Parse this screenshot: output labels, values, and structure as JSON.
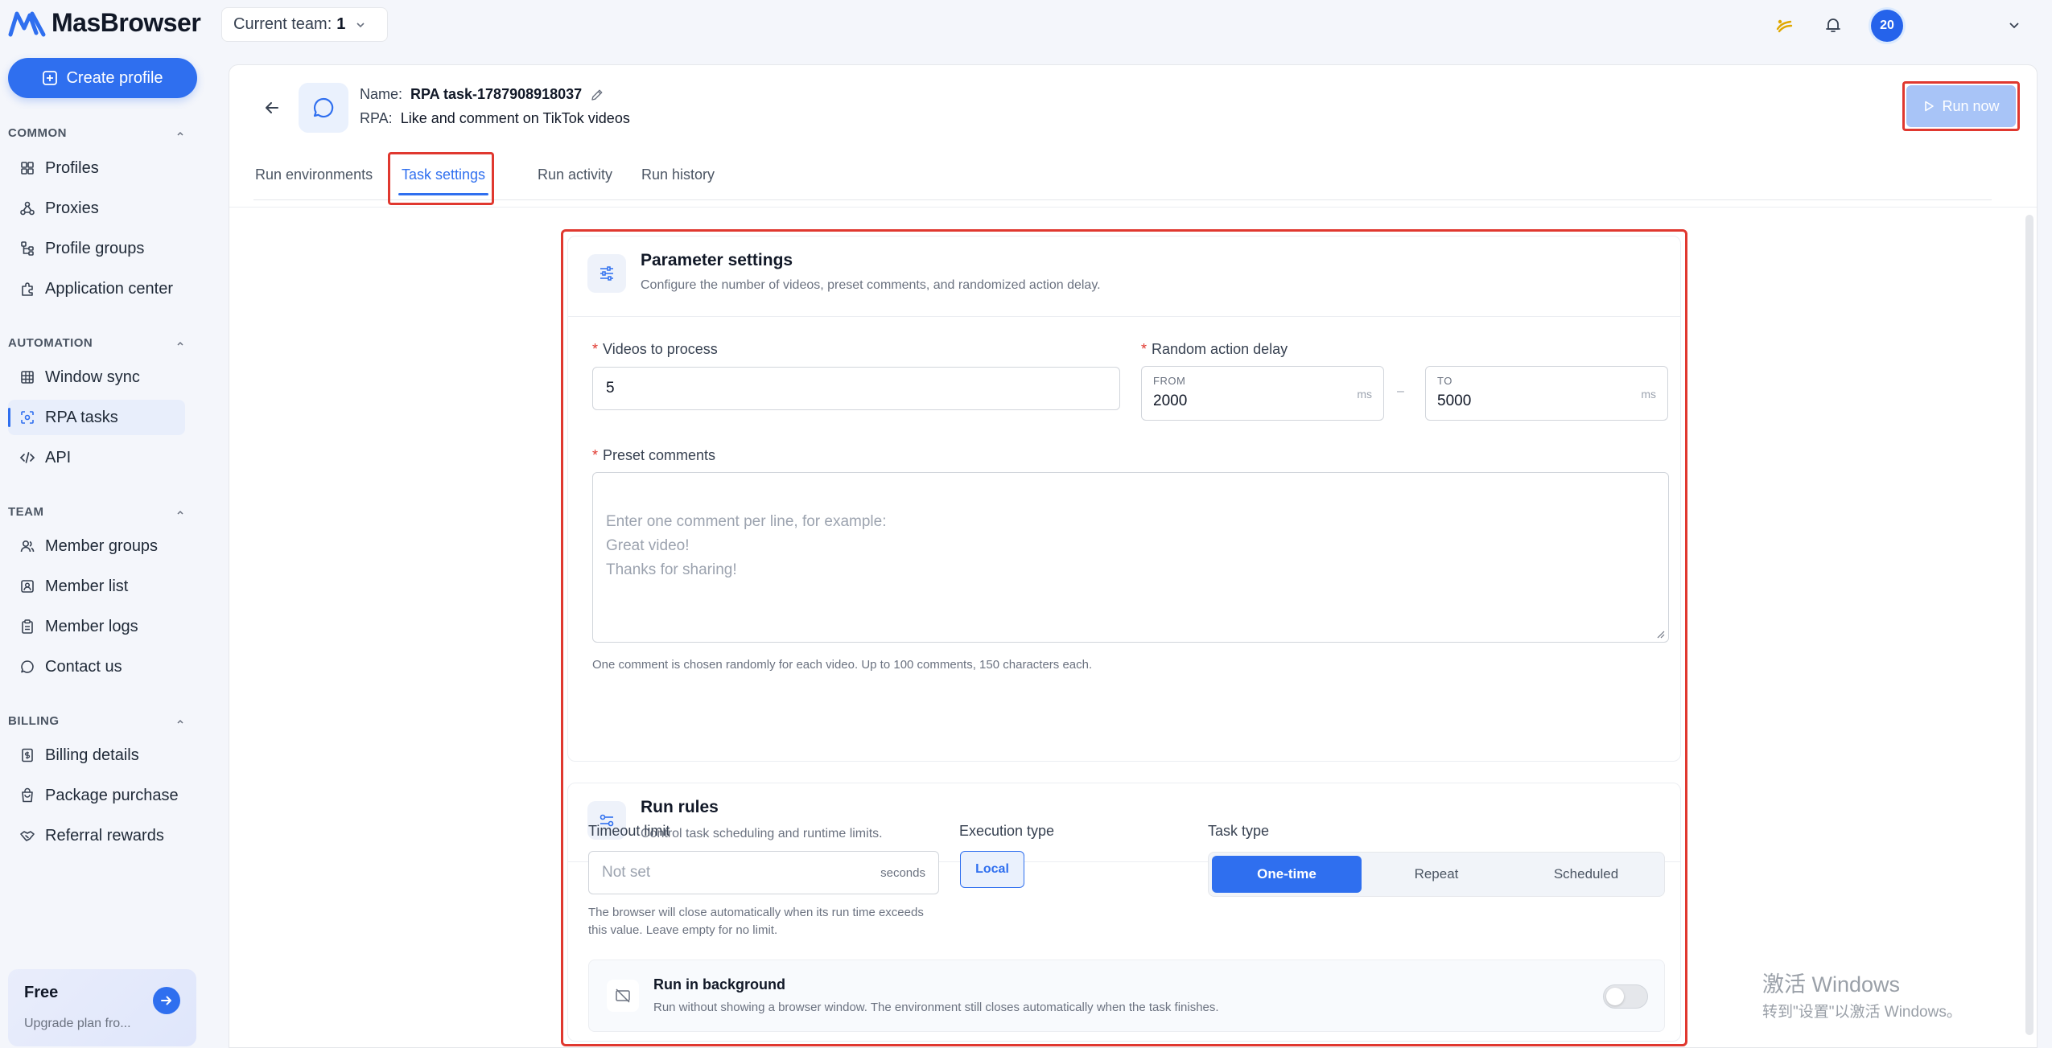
{
  "app": {
    "logo_text": "MasBrowser",
    "team_label": "Current team:",
    "team_value": "1",
    "avatar_text": "20"
  },
  "sidebar": {
    "create_profile": "Create profile",
    "sections": {
      "common": "COMMON",
      "automation": "AUTOMATION",
      "team": "TEAM",
      "billing": "BILLING"
    },
    "items": {
      "profiles": "Profiles",
      "proxies": "Proxies",
      "profile_groups": "Profile groups",
      "application_center": "Application center",
      "window_sync": "Window sync",
      "rpa_tasks": "RPA tasks",
      "api": "API",
      "member_groups": "Member groups",
      "member_list": "Member list",
      "member_logs": "Member logs",
      "contact_us": "Contact us",
      "billing_details": "Billing details",
      "package_purchase": "Package purchase",
      "referral_rewards": "Referral rewards"
    },
    "plan": {
      "name": "Free",
      "subtitle": "Upgrade plan fro..."
    }
  },
  "task": {
    "name_label": "Name:",
    "name_value": "RPA task-1787908918037",
    "rpa_label": "RPA:",
    "rpa_value": "Like and comment on TikTok videos",
    "run_now": "Run now"
  },
  "tabs": {
    "run_environments": "Run environments",
    "task_settings": "Task settings",
    "run_activity": "Run activity",
    "run_history": "Run history"
  },
  "parameter_settings": {
    "title": "Parameter settings",
    "subtitle": "Configure the number of videos, preset comments, and randomized action delay.",
    "videos_label": "Videos to process",
    "videos_value": "5",
    "delay_label": "Random action delay",
    "from_caption": "FROM",
    "from_value": "2000",
    "to_caption": "TO",
    "to_value": "5000",
    "unit": "ms",
    "dash": "–",
    "comments_label": "Preset comments",
    "comments_placeholder": "Enter one comment per line, for example:\nGreat video!\nThanks for sharing!",
    "comments_hint": "One comment is chosen randomly for each video. Up to 100 comments, 150 characters each."
  },
  "run_rules": {
    "title": "Run rules",
    "subtitle": "Control task scheduling and runtime limits.",
    "timeout_label": "Timeout limit",
    "timeout_placeholder": "Not set",
    "timeout_unit": "seconds",
    "timeout_hint_1": "The browser will close automatically when its run time exceeds",
    "timeout_hint_2": "this value. Leave empty for no limit.",
    "execution_label": "Execution type",
    "execution_value": "Local",
    "task_type_label": "Task type",
    "task_types": [
      "One-time",
      "Repeat",
      "Scheduled"
    ],
    "task_type_selected": "One-time",
    "background_title": "Run in background",
    "background_sub": "Run without showing a browser window. The environment still closes automatically when the task finishes.",
    "background_enabled": false
  },
  "watermark": {
    "line1": "激活 Windows",
    "line2": "转到\"设置\"以激活 Windows。"
  },
  "colors": {
    "accent": "#2f6fef",
    "highlight_border": "#e0382f"
  }
}
